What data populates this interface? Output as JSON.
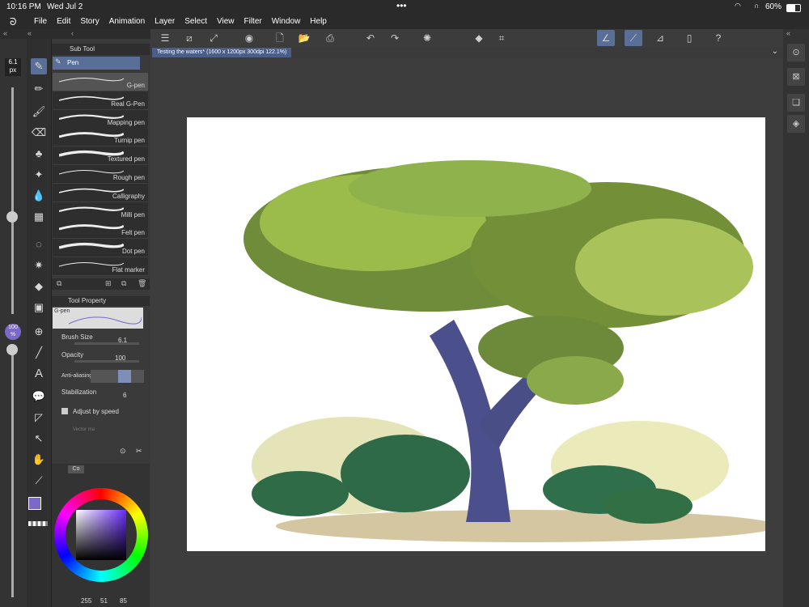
{
  "status": {
    "time": "10:16 PM",
    "date": "Wed Jul 2",
    "battery": "60%"
  },
  "menu": [
    "File",
    "Edit",
    "Story",
    "Animation",
    "Layer",
    "Select",
    "View",
    "Filter",
    "Window",
    "Help"
  ],
  "brush_readout": "6.1\npx",
  "opacity_readout": "100\n%",
  "subtool": {
    "header": "Sub Tool",
    "group": "Pen",
    "items": [
      "G-pen",
      "Real G-Pen",
      "Mapping pen",
      "Turnip pen",
      "Textured pen",
      "Rough pen",
      "Calligraphy",
      "Milli pen",
      "Felt pen",
      "Dot pen",
      "Flat marker"
    ],
    "selected_index": 0
  },
  "tool_property": {
    "header": "Tool Property",
    "preset": "G-pen",
    "brush_size_label": "Brush Size",
    "brush_size_value": "6.1",
    "opacity_label": "Opacity",
    "opacity_value": "100",
    "antialiasing_label": "Anti-aliasing",
    "stabilization_label": "Stabilization",
    "stabilization_value": "6",
    "adjust_by_speed_label": "Adjust by speed",
    "vector_label": "Vector ma"
  },
  "color_panel": {
    "tab": "Co",
    "r": "255",
    "g": "51",
    "b": "85"
  },
  "document": {
    "tab_label": "Testing the waters* (1600 x 1200px 300dpi 122.1%)"
  },
  "colors": {
    "accent": "#5a6f98",
    "main_color": "#7b68c8",
    "sub_color": "#ffffff"
  }
}
